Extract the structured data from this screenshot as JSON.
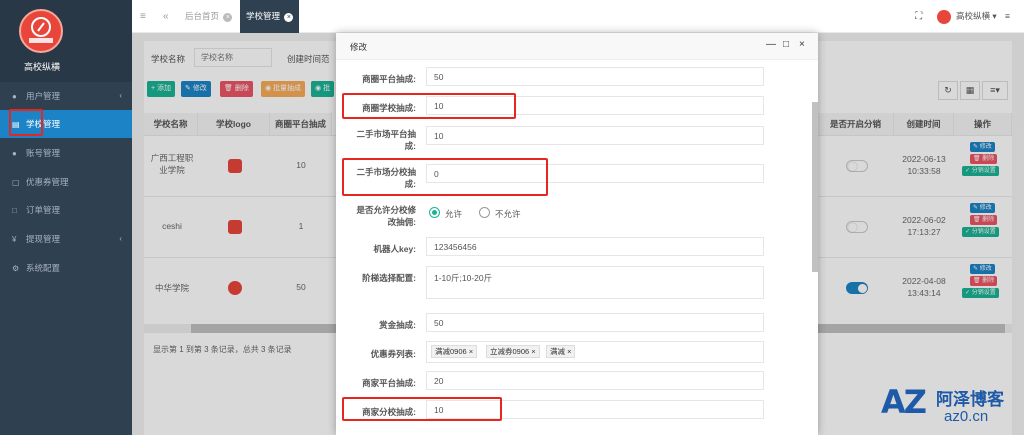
{
  "sidebar": {
    "logo_title": "高校纵横",
    "items": [
      {
        "label": "用户管理",
        "icon": "user-icon",
        "has_caret": true
      },
      {
        "label": "学校管理",
        "icon": "document-icon",
        "has_caret": false
      },
      {
        "label": "账号管理",
        "icon": "users-icon",
        "has_caret": false
      },
      {
        "label": "优惠券管理",
        "icon": "coupon-icon",
        "has_caret": false
      },
      {
        "label": "订单管理",
        "icon": "order-icon",
        "has_caret": false
      },
      {
        "label": "提现管理",
        "icon": "yen-icon",
        "has_caret": true
      },
      {
        "label": "系统配置",
        "icon": "gear-icon",
        "has_caret": false
      }
    ]
  },
  "topbar": {
    "tabs": [
      "后台首页",
      "学校管理"
    ],
    "user_name": "高校纵横"
  },
  "search": {
    "school_label": "学校名称",
    "school_placeholder": "学校名称",
    "time_label": "创建时间范"
  },
  "toolbar": {
    "add": "添加",
    "edit": "修改",
    "delete": "删除",
    "batch": "批量抽成",
    "other": "批"
  },
  "table": {
    "headers": [
      "学校名称",
      "学校logo",
      "商圈平台抽成",
      "是否开启分销",
      "创建时间",
      "操作"
    ],
    "rows": [
      {
        "name": "广西工程职业学院",
        "platform_rate": "10",
        "distribution": false,
        "date": "2022-06-13",
        "time": "10:33:58"
      },
      {
        "name": "ceshi",
        "platform_rate": "1",
        "distribution": false,
        "date": "2022-06-02",
        "time": "17:13:27"
      },
      {
        "name": "中华学院",
        "platform_rate": "50",
        "distribution": true,
        "date": "2022-04-08",
        "time": "13:43:14"
      }
    ],
    "op_edit": "修改",
    "op_delete": "删除",
    "op_dist": "分销设置",
    "footer": "显示第 1 到第 3 条记录，总共 3 条记录"
  },
  "modal": {
    "title": "修改",
    "fields": {
      "f1_label": "商圈平台抽成:",
      "f1_value": "50",
      "f2_label": "商圈学校抽成:",
      "f2_value": "10",
      "f3_label_a": "二手市场平台抽",
      "f3_label_b": "成:",
      "f3_value": "10",
      "f4_label_a": "二手市场分校抽",
      "f4_label_b": "成:",
      "f4_value": "0",
      "f5_label_a": "是否允许分校修",
      "f5_label_b": "改抽佣:",
      "f5_opt_yes": "允许",
      "f5_opt_no": "不允许",
      "f6_label": "机器人key:",
      "f6_value": "123456456",
      "f7_label": "阶梯选择配置:",
      "f7_value": "1-10斤;10-20斤",
      "f8_label": "赏金抽成:",
      "f8_value": "50",
      "f9_label": "优惠券列表:",
      "f9_tags": [
        "满减0906",
        "立减券0906",
        "满减"
      ],
      "f10_label": "商家平台抽成:",
      "f10_value": "20",
      "f11_label": "商家分校抽成:",
      "f11_value": "10"
    }
  },
  "watermark": {
    "az": "AZ",
    "cn": "阿泽博客",
    "url": "az0.cn"
  },
  "colors": {
    "sidebar": "#2f4050",
    "active": "#1c84c6",
    "highlight": "#e6261f",
    "green": "#1ab394"
  }
}
